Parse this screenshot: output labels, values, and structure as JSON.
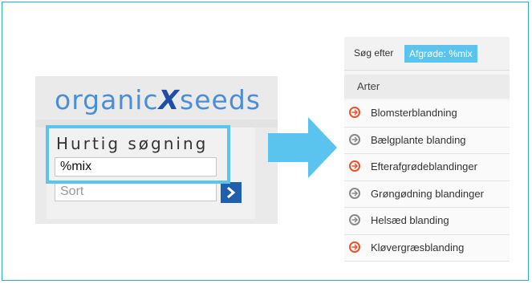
{
  "widget": {
    "logo_left": "organic",
    "logo_x": "X",
    "logo_right": "seeds",
    "title": "Hurtig søgning",
    "search_value": "%mix",
    "sort_placeholder": "Sort",
    "go_icon": "chevron-right-icon"
  },
  "results": {
    "search_label": "Søg efter",
    "search_tag": "Afgrøde: %mix",
    "section_header": "Arter",
    "items": [
      {
        "label": "Blomsterblandning",
        "icon": "arrow-right-circle-icon",
        "color": "#e8522a"
      },
      {
        "label": "Bælgplante blanding",
        "icon": "arrow-right-circle-icon",
        "color": "#888888"
      },
      {
        "label": "Efterafgrødeblandinger",
        "icon": "arrow-right-circle-icon",
        "color": "#e8522a"
      },
      {
        "label": "Grøngødning blandinger",
        "icon": "arrow-right-circle-icon",
        "color": "#888888"
      },
      {
        "label": "Helsæd blanding",
        "icon": "arrow-right-circle-icon",
        "color": "#888888"
      },
      {
        "label": "Kløvergræsblanding",
        "icon": "arrow-right-circle-icon",
        "color": "#e8522a"
      }
    ]
  },
  "colors": {
    "accent": "#5ac4ee",
    "brand_blue": "#1f5fae",
    "logo_blue": "#4a8fd6",
    "active_orange": "#e8522a",
    "inactive_grey": "#888888"
  }
}
